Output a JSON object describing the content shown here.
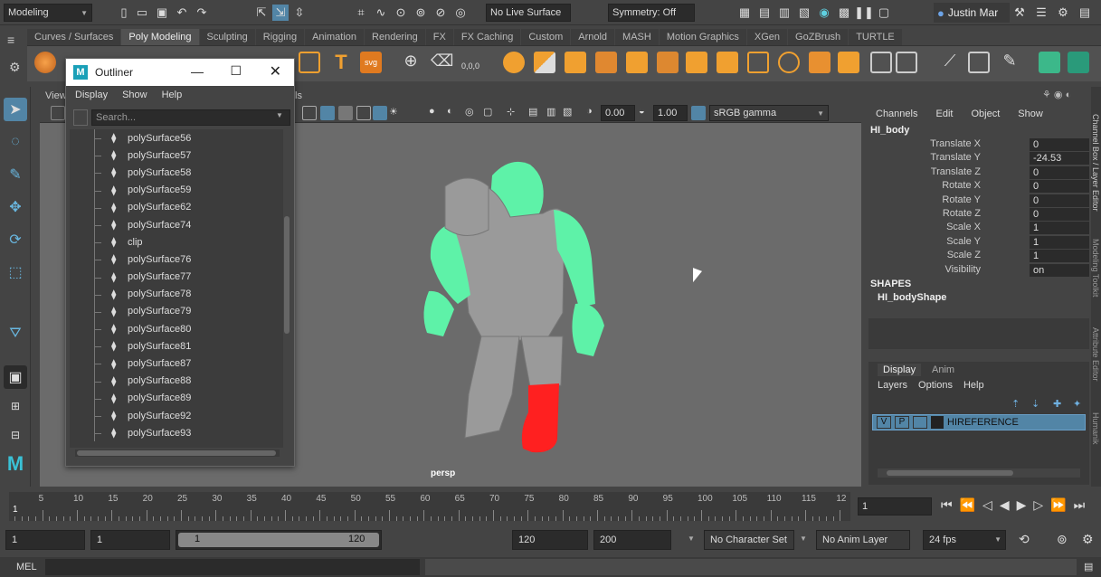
{
  "topbar": {
    "mode": "Modeling",
    "live_surface": "No Live Surface",
    "symmetry": "Symmetry: Off",
    "user": "Justin Mar"
  },
  "shelf_tabs": [
    "Curves / Surfaces",
    "Poly Modeling",
    "Sculpting",
    "Rigging",
    "Animation",
    "Rendering",
    "FX",
    "FX Caching",
    "Custom",
    "Arnold",
    "MASH",
    "Motion Graphics",
    "XGen",
    "GoZBrush",
    "TURTLE"
  ],
  "viewport": {
    "menu": [
      "View"
    ],
    "menu_right": "ls",
    "exposure": "0.00",
    "gamma": "1.00",
    "colorspace": "sRGB gamma",
    "camera": "persp"
  },
  "outliner": {
    "title": "Outliner",
    "menu": [
      "Display",
      "Show",
      "Help"
    ],
    "search_placeholder": "Search...",
    "items": [
      "polySurface56",
      "polySurface57",
      "polySurface58",
      "polySurface59",
      "polySurface62",
      "polySurface74",
      "clip",
      "polySurface76",
      "polySurface77",
      "polySurface78",
      "polySurface79",
      "polySurface80",
      "polySurface81",
      "polySurface87",
      "polySurface88",
      "polySurface89",
      "polySurface92",
      "polySurface93"
    ]
  },
  "channel_box": {
    "menu": [
      "Channels",
      "Edit",
      "Object",
      "Show"
    ],
    "object": "HI_body",
    "channels": [
      {
        "k": "Translate X",
        "v": "0"
      },
      {
        "k": "Translate Y",
        "v": "-24.53"
      },
      {
        "k": "Translate Z",
        "v": "0"
      },
      {
        "k": "Rotate X",
        "v": "0"
      },
      {
        "k": "Rotate Y",
        "v": "0"
      },
      {
        "k": "Rotate Z",
        "v": "0"
      },
      {
        "k": "Scale X",
        "v": "1"
      },
      {
        "k": "Scale Y",
        "v": "1"
      },
      {
        "k": "Scale Z",
        "v": "1"
      },
      {
        "k": "Visibility",
        "v": "on"
      }
    ],
    "shapes_label": "SHAPES",
    "shape_name": "HI_bodyShape",
    "side_tabs": [
      "Channel Box / Layer Editor",
      "Modeling Toolkit",
      "Attribute Editor",
      "Humanik"
    ]
  },
  "layers": {
    "tabs": [
      "Display",
      "Anim"
    ],
    "menu": [
      "Layers",
      "Options",
      "Help"
    ],
    "layer": {
      "v": "V",
      "p": "P",
      "name": "HIREFERENCE"
    }
  },
  "timeline": {
    "ticks": [
      "5",
      "10",
      "15",
      "20",
      "25",
      "30",
      "35",
      "40",
      "45",
      "50",
      "55",
      "60",
      "65",
      "70",
      "75",
      "80",
      "85",
      "90",
      "95",
      "100",
      "105",
      "110",
      "115",
      "12"
    ],
    "start_marker": "1",
    "current_frame": "1"
  },
  "range": {
    "start": "1",
    "playback_start": "1",
    "slider_start": "1",
    "slider_end": "120",
    "playback_end": "120",
    "end": "200",
    "character_set": "No Character Set",
    "anim_layer": "No Anim Layer",
    "fps": "24 fps"
  },
  "command_line": {
    "label": "MEL"
  },
  "colors": {
    "selection_green": "#5ef2a8",
    "selection_red": "#ff2020",
    "accent": "#5285a6"
  }
}
